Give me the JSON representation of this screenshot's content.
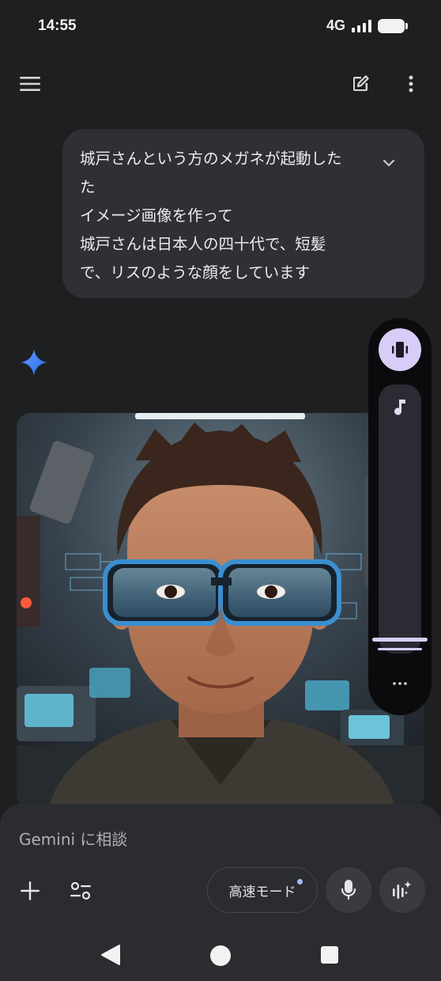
{
  "status": {
    "time": "14:55",
    "network": "4G"
  },
  "user_message": {
    "text": "城戸さんという方のメガネが起動した\nた\nイメージ画像を作って\n城戸さんは日本人の四十代で、短髪\nで、リスのような顔をしています"
  },
  "composer": {
    "placeholder": "Gemini に相談",
    "mode_label": "高速モード"
  },
  "icons": {
    "menu": "hamburger-menu-icon",
    "new_chat": "edit-icon",
    "more": "more-vert-icon",
    "expand": "chevron-down-icon",
    "gemini": "gemini-spark-icon",
    "vibrate": "vibrate-icon",
    "music": "music-note-icon",
    "add": "plus-icon",
    "tools": "tune-icon",
    "mic": "mic-icon",
    "live": "gemini-live-icon"
  },
  "colors": {
    "background": "#1e1f21",
    "bubble": "#2f3033",
    "accent": "#d9cdf7",
    "gemini_blue": "#4285f4"
  }
}
